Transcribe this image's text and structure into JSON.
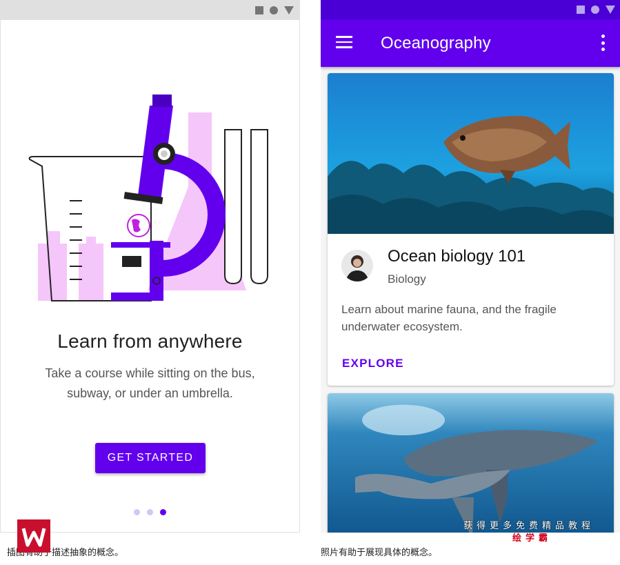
{
  "left_screen": {
    "title": "Learn from anywhere",
    "body": "Take a course while sitting on the bus, subway, or under an umbrella.",
    "button_label": "GET STARTED",
    "pager": {
      "total": 3,
      "active": 3
    },
    "illustration_icons": [
      "beaker-icon",
      "microscope-icon",
      "flask-icon",
      "test-tube-icon",
      "globe-icon"
    ]
  },
  "right_screen": {
    "app_title": "Oceanography",
    "card1": {
      "title": "Ocean biology 101",
      "subtitle": "Biology",
      "body": "Learn about marine fauna, and the fragile underwater ecosystem.",
      "action": "EXPLORE"
    }
  },
  "captions": {
    "left": "插图有助于描述抽象的概念。",
    "right": "照片有助于展现具体的概念。"
  },
  "watermark": {
    "text": "获得更多免费精品教程",
    "brand": "绘学霸"
  },
  "colors": {
    "primary": "#6200ee",
    "primary_dark": "#4a00d4",
    "illustration_pink": "#f5c6fa"
  }
}
